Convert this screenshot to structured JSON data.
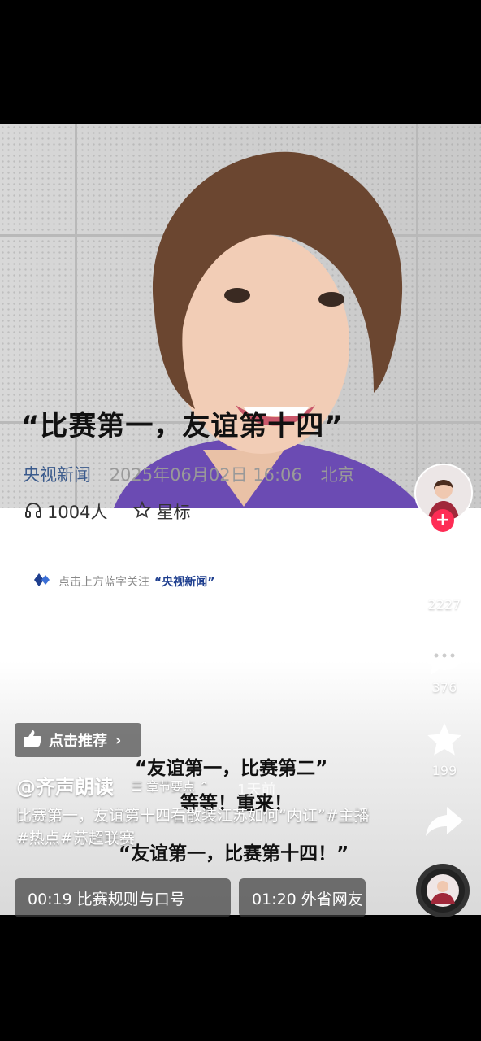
{
  "article": {
    "headline": "“比赛第一，友谊第十四”",
    "source": "央视新闻",
    "date": "2025年06月02日 16:06",
    "location": "北京",
    "listeners": "1004人",
    "star_label": "星标",
    "follow_hint": "点击上方蓝字关注",
    "follow_brand": "“央视新闻”",
    "quote_line_1": "“友谊第一，比赛第二”",
    "quote_line_2": "等等！重来！",
    "quote_line_3": "“友谊第一，比赛第十四！”"
  },
  "overlay": {
    "recommend_label": "点击推荐",
    "author": "@齐声朗读",
    "chapters_label": "章节要点",
    "time_ago": "1天前",
    "caption": "比赛第一，友谊第十四看散装江苏如何“内讧”#主播#热点#苏超联赛",
    "chapter_1": "00:19  比赛规则与口号",
    "chapter_2": "01:20  外省网友"
  },
  "rail": {
    "likes": "2227",
    "comments": "376",
    "favorites": "199"
  },
  "colors": {
    "accent": "#fe2c55",
    "source_link": "#3a5a8c"
  }
}
